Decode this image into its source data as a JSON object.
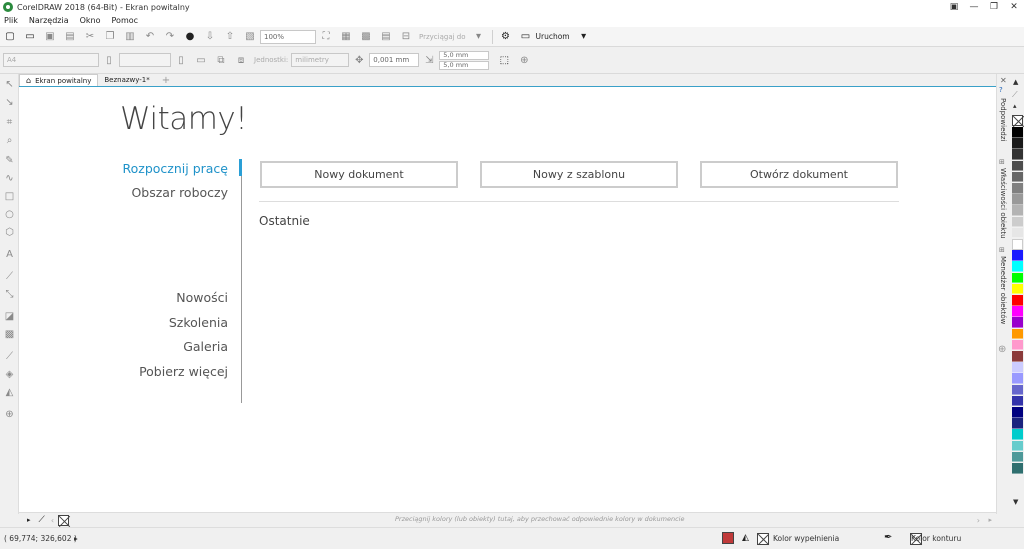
{
  "window": {
    "title": "CorelDRAW 2018 (64-Bit) - Ekran powitalny",
    "controls": [
      "▣",
      "—",
      "❐",
      "✕"
    ]
  },
  "menu": [
    "Plik",
    "Narzędzia",
    "Okno",
    "Pomoc"
  ],
  "toolbar1": {
    "zoom_value": "100%",
    "snap_label": "Przyciągaj do",
    "launch_label": "Uruchom"
  },
  "toolbar2": {
    "page_size": "A4",
    "units_label": "Jednostki:",
    "units_value": "milimetry",
    "nudge_value": "0,001 mm",
    "dup_x": "5,0 mm",
    "dup_y": "5,0 mm"
  },
  "tabs": [
    {
      "label": "Ekran powitalny",
      "icon": "home-icon"
    },
    {
      "label": "Beznazwy-1*"
    }
  ],
  "welcome": {
    "heading": "Witamy!",
    "nav": [
      "Rozpocznij pracę",
      "Obszar roboczy",
      "Nowości",
      "Szkolenia",
      "Galeria",
      "Pobierz więcej"
    ],
    "buttons": [
      "Nowy dokument",
      "Nowy z szablonu",
      "Otwórz dokument"
    ],
    "recent_label": "Ostatnie"
  },
  "docker_tabs": [
    "Podpowiedzi",
    "Właściwości obiektu",
    "Menedżer obiektów"
  ],
  "palette_colors": [
    "#000000",
    "#1a1a1a",
    "#333333",
    "#4d4d4d",
    "#666666",
    "#808080",
    "#999999",
    "#b3b3b3",
    "#cccccc",
    "#e6e6e6",
    "#ffffff",
    "#1a1aff",
    "#00ffff",
    "#00ff00",
    "#ffff00",
    "#ff0000",
    "#ff00ff",
    "#9900cc",
    "#ff9900",
    "#ff99cc",
    "#8b3a3a",
    "#ccccff",
    "#9999ff",
    "#6666cc",
    "#3333aa",
    "#000080",
    "#1a237e",
    "#00cccc",
    "#66cccc",
    "#4d9999",
    "#2f6f6f"
  ],
  "doc_palette_hint": "Przeciągnij kolory (lub obiekty) tutaj, aby przechować odpowiednie kolory w dokumencie",
  "status": {
    "coordinates": "( 69,774; 326,602 )",
    "fill_label": "Kolor wypełnienia",
    "outline_label": "Kolor konturu"
  }
}
